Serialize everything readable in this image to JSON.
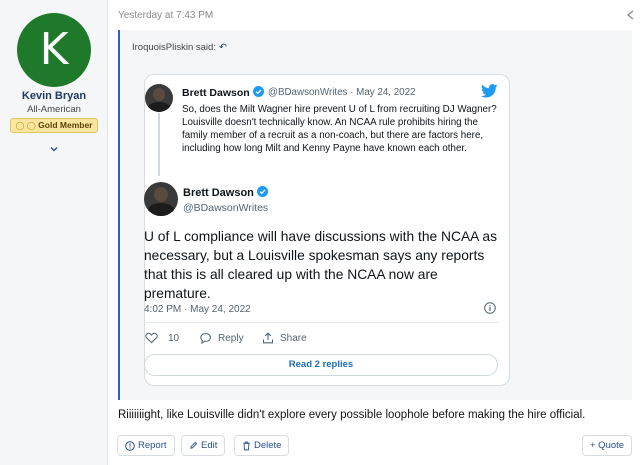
{
  "user": {
    "avatar_letter": "K",
    "avatar_color": "#1e7a2a",
    "name": "Kevin Bryan",
    "title": "All-American",
    "badge": "Gold Member",
    "badge_icon": "shield-icon"
  },
  "post": {
    "timestamp": "Yesterday at 7:43 PM",
    "quote_author": "IroquoisPliskin said:",
    "body": "Riiiiiiight, like Louisville didn't explore every possible loophole before making the hire official."
  },
  "tweet": {
    "reply": {
      "name": "Brett Dawson",
      "handle_date": "@BDawsonWrites · May 24, 2022",
      "text": "So, does the Milt Wagner hire prevent U of L from recruiting DJ Wagner? Louisville doesn't technically know. An NCAA rule prohibits hiring the family member of a recruit as a non-coach, but there are factors here, including how long Milt and Kenny Payne have known each other."
    },
    "main": {
      "name": "Brett Dawson",
      "handle": "@BDawsonWrites",
      "text": "U of L compliance will have discussions with the NCAA as necessary, but a Louisville spokesman says any reports that this is all cleared up with the NCAA now are premature.",
      "time": "4:02 PM · May 24, 2022"
    },
    "likes": "10",
    "reply_label": "Reply",
    "share_label": "Share",
    "read_replies": "Read 2 replies",
    "accent": "#1d9bf0"
  },
  "actions": {
    "report": "Report",
    "edit": "Edit",
    "delete": "Delete",
    "quote": "+ Quote"
  }
}
